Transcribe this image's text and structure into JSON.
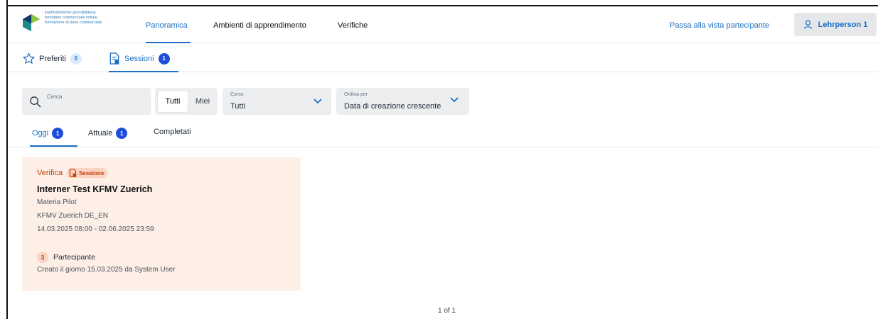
{
  "header": {
    "logo_text": [
      "kaufmännische grundbildung",
      "formation commerciale initiale",
      "formazione di base commerciale"
    ],
    "nav": [
      {
        "label": "Panoramica",
        "active": true
      },
      {
        "label": "Ambienti di apprendimento",
        "active": false
      },
      {
        "label": "Verifiche",
        "active": false
      }
    ],
    "switch_view": "Passa alla vista partecipante",
    "user": {
      "label": "Lehrperson 1",
      "icon": "user-icon"
    }
  },
  "subnav": {
    "favorites": {
      "label": "Preferiti",
      "count": "0",
      "icon": "star-icon"
    },
    "sessions": {
      "label": "Sessioni",
      "count": "1",
      "icon": "document-icon"
    }
  },
  "filters": {
    "search_placeholder": "Cerca",
    "scope": {
      "all": "Tutti",
      "mine": "Miei",
      "selected": "Tutti"
    },
    "course": {
      "label": "Corso",
      "value": "Tutti"
    },
    "sort": {
      "label": "Ordina per",
      "value": "Data di creazione crescente"
    }
  },
  "tabs": [
    {
      "label": "Oggi",
      "count": "1",
      "active": true
    },
    {
      "label": "Attuale",
      "count": "1",
      "active": false
    },
    {
      "label": "Completati",
      "count": null,
      "active": false
    }
  ],
  "card": {
    "kind": "Verifica",
    "badge": "Sessione",
    "title": "Interner Test KFMV Zuerich",
    "subject": "Materia Pilot",
    "class": "KFMV Zuerich DE_EN",
    "period": "14.03.2025 08:00 - 02.06.2025 23:59",
    "participants_count": "3",
    "participants_label": "Partecipante",
    "created": "Creato il giorno 15.03.2025 da System User"
  },
  "pagination": "1 of 1",
  "colors": {
    "accent": "#1d6fc1",
    "card_bg": "#fdeee6",
    "card_accent": "#c2410c"
  }
}
